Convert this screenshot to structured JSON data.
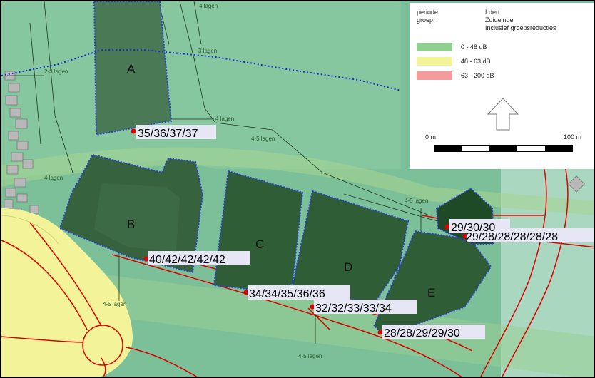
{
  "legend": {
    "periode_key": "periode:",
    "periode_val": "Lden",
    "groep_key": "groep:",
    "groep_val": "Zuideinde",
    "groep_val2": "Inclusief groepsreducties",
    "classes": [
      {
        "label": "0 - 48 dB",
        "color": "#8fcf8f"
      },
      {
        "label": "48 - 63 dB",
        "color": "#f3f39a"
      },
      {
        "label": "63 - 200 dB",
        "color": "#f59b9b"
      }
    ],
    "north_arrow": "north-arrow-icon",
    "scale_start": "0 m",
    "scale_end": "100 m"
  },
  "buildings": {
    "A": "A",
    "B": "B",
    "C": "C",
    "D": "D",
    "E": "E"
  },
  "floors": {
    "f1": "4 lagen",
    "f2": "2-3 lagen",
    "f3": "3 lagen",
    "f4": "4 lagen",
    "f5": "4-5 lagen",
    "f6": "4 lagen",
    "f7": "4-5 lagen",
    "f8": "4-5 lagen",
    "f9": "4-5 lagen"
  },
  "points": {
    "p1": "35/36/37/37",
    "p2": "40/42/42/42/42",
    "p3": "34/34/35/36/36",
    "p4": "32/32/33/33/34",
    "p5": "28/28/29/29/30",
    "p6": "29/30/30",
    "p7": "29/28/28/28/28/28"
  },
  "colors": {
    "green_zone": "#8fcf8f",
    "yellow_zone": "#f3f39a",
    "building_dark": "#2f5d35",
    "point": "#e00000",
    "contour": "#2a3fd0",
    "road": "#e00000"
  }
}
